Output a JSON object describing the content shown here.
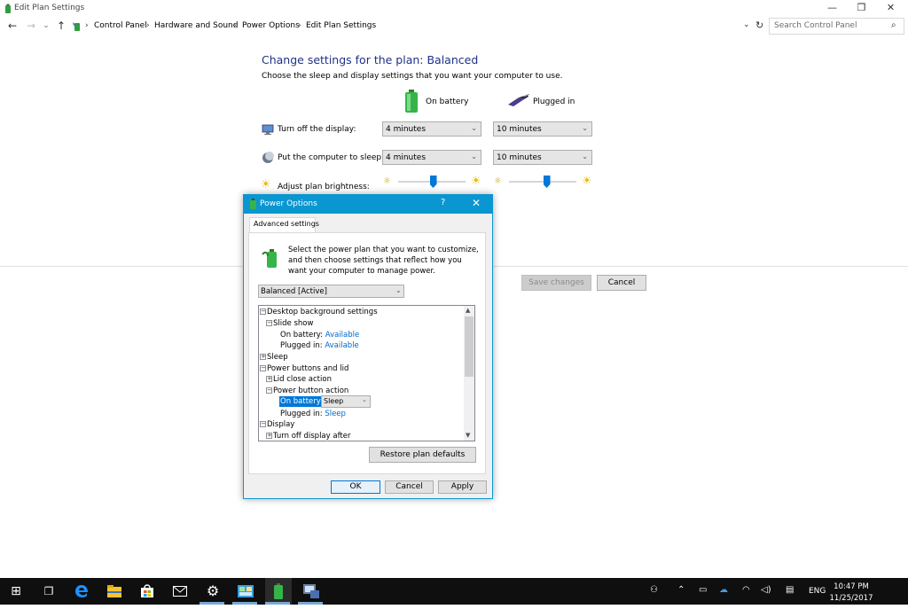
{
  "window": {
    "title": "Edit Plan Settings",
    "minimize": "—",
    "restore": "❐",
    "close": "✕"
  },
  "nav": {
    "back": "←",
    "forward": "→",
    "recent": "⌄",
    "up": "↑"
  },
  "breadcrumb": {
    "items": [
      "Control Panel",
      "Hardware and Sound",
      "Power Options",
      "Edit Plan Settings"
    ],
    "sep": "›",
    "dropdown": "⌄",
    "refresh": "↻"
  },
  "search": {
    "placeholder": "Search Control Panel",
    "icon": "⌕"
  },
  "plan": {
    "heading": "Change settings for the plan: Balanced",
    "subheading": "Choose the sleep and display settings that you want your computer to use.",
    "on_battery": "On battery",
    "plugged_in": "Plugged in",
    "display_label": "Turn off the display:",
    "display_battery": "4 minutes",
    "display_plugged": "10 minutes",
    "sleep_label": "Put the computer to sleep:",
    "sleep_battery": "4 minutes",
    "sleep_plugged": "10 minutes",
    "brightness_label": "Adjust plan brightness:",
    "brightness_battery": 0.52,
    "brightness_plugged": 0.56,
    "chevron": "⌄",
    "sun_small": "☼",
    "sun_big": "☀",
    "save_button": "Save changes",
    "cancel_button": "Cancel"
  },
  "dialog": {
    "title": "Power Options",
    "help": "?",
    "close": "✕",
    "tab": "Advanced settings",
    "description": "Select the power plan that you want to customize, and then choose settings that reflect how you want your computer to manage power.",
    "plan_select": "Balanced [Active]",
    "chevron": "⌄",
    "tree": {
      "desktop_bg": "Desktop background settings",
      "slide_show": "Slide show",
      "on_battery": "On battery:",
      "plugged_in": "Plugged in:",
      "available": "Available",
      "sleep": "Sleep",
      "power_buttons": "Power buttons and lid",
      "lid_close": "Lid close action",
      "power_button": "Power button action",
      "pb_battery_value": "Sleep",
      "pb_plugged_value": "Sleep",
      "display": "Display",
      "turn_off_display": "Turn off display after",
      "minus": "−",
      "plus": "+",
      "scroll_up": "▲",
      "scroll_down": "▼"
    },
    "restore_button": "Restore plan defaults",
    "ok_button": "OK",
    "cancel_button": "Cancel",
    "apply_button": "Apply"
  },
  "taskbar": {
    "start": "⊞",
    "task_view": "❐",
    "tray_people": "⚇",
    "tray_chevron": "⌃",
    "tray_battery": "▭",
    "tray_cloud": "☁",
    "tray_wifi": "◠",
    "tray_volume": "◁)",
    "tray_notify": "▤",
    "language": "ENG",
    "time": "10:47 PM",
    "date": "11/25/2017",
    "colors": {
      "edge": "#1e90ff",
      "folder": "#f4c430",
      "store": "#ffffff"
    }
  }
}
